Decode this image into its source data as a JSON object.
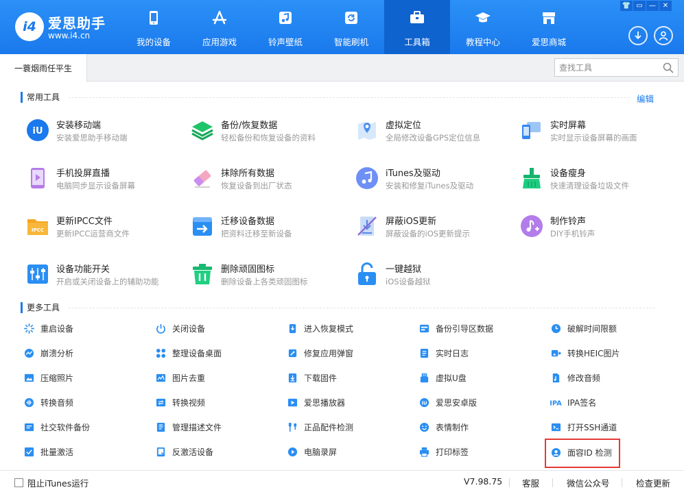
{
  "brand": {
    "name": "爱思助手",
    "url": "www.i4.cn",
    "badge": "i4"
  },
  "nav": [
    {
      "label": "我的设备",
      "icon": "phone-icon"
    },
    {
      "label": "应用游戏",
      "icon": "app-store-icon"
    },
    {
      "label": "铃声壁纸",
      "icon": "music-icon"
    },
    {
      "label": "智能刷机",
      "icon": "refresh-icon"
    },
    {
      "label": "工具箱",
      "icon": "toolbox-icon",
      "active": true
    },
    {
      "label": "教程中心",
      "icon": "graduation-cap-icon"
    },
    {
      "label": "爱思商城",
      "icon": "shop-icon"
    }
  ],
  "window_controls": [
    "👕",
    "▭",
    "—",
    "✕"
  ],
  "tab": {
    "label": "一蓑烟雨任平生"
  },
  "search": {
    "placeholder": "查找工具"
  },
  "common": {
    "title": "常用工具",
    "edit": "编辑",
    "tools": [
      {
        "title": "安装移动端",
        "desc": "安装爱思助手移动端",
        "icon": "i4-app-icon"
      },
      {
        "title": "备份/恢复数据",
        "desc": "轻松备份和恢复设备的资料",
        "icon": "layers-icon"
      },
      {
        "title": "虚拟定位",
        "desc": "全局修改设备GPS定位信息",
        "icon": "map-pin-icon"
      },
      {
        "title": "实时屏幕",
        "desc": "实时显示设备屏幕的画面",
        "icon": "screen-mirror-icon"
      },
      {
        "title": "手机投屏直播",
        "desc": "电脑同步显示设备屏幕",
        "icon": "phone-cast-icon"
      },
      {
        "title": "抹除所有数据",
        "desc": "恢复设备到出厂状态",
        "icon": "eraser-icon"
      },
      {
        "title": "iTunes及驱动",
        "desc": "安装和修复iTunes及驱动",
        "icon": "itunes-icon"
      },
      {
        "title": "设备瘦身",
        "desc": "快速清理设备垃圾文件",
        "icon": "broom-icon"
      },
      {
        "title": "更新IPCC文件",
        "desc": "更新IPCC运营商文件",
        "icon": "ipcc-folder-icon"
      },
      {
        "title": "迁移设备数据",
        "desc": "把资料迁移至新设备",
        "icon": "migrate-icon"
      },
      {
        "title": "屏蔽iOS更新",
        "desc": "屏蔽设备的iOS更新提示",
        "icon": "block-update-icon"
      },
      {
        "title": "制作铃声",
        "desc": "DIY手机铃声",
        "icon": "ringtone-icon"
      },
      {
        "title": "设备功能开关",
        "desc": "开启或关闭设备上的辅助功能",
        "icon": "switches-icon"
      },
      {
        "title": "删除顽固图标",
        "desc": "删除设备上各类顽固图标",
        "icon": "trash-icon"
      },
      {
        "title": "一键越狱",
        "desc": "iOS设备越狱",
        "icon": "unlock-icon"
      }
    ]
  },
  "more": {
    "title": "更多工具",
    "items": [
      {
        "label": "重启设备",
        "icon": "spinner-icon"
      },
      {
        "label": "关闭设备",
        "icon": "power-icon"
      },
      {
        "label": "进入恢复模式",
        "icon": "recovery-icon"
      },
      {
        "label": "备份引导区数据",
        "icon": "boot-backup-icon"
      },
      {
        "label": "破解时间限额",
        "icon": "clock-icon"
      },
      {
        "label": "崩溃分析",
        "icon": "crash-chart-icon"
      },
      {
        "label": "整理设备桌面",
        "icon": "grid-icon"
      },
      {
        "label": "修复应用弹窗",
        "icon": "repair-icon"
      },
      {
        "label": "实时日志",
        "icon": "log-icon"
      },
      {
        "label": "转换HEIC图片",
        "icon": "convert-image-icon"
      },
      {
        "label": "压缩照片",
        "icon": "photo-icon"
      },
      {
        "label": "图片去重",
        "icon": "dedupe-icon"
      },
      {
        "label": "下载固件",
        "icon": "download-icon"
      },
      {
        "label": "虚拟U盘",
        "icon": "usb-icon"
      },
      {
        "label": "修改音频",
        "icon": "audio-edit-icon"
      },
      {
        "label": "转换音频",
        "icon": "audio-convert-icon"
      },
      {
        "label": "转换视频",
        "icon": "video-convert-icon"
      },
      {
        "label": "爱思播放器",
        "icon": "player-icon"
      },
      {
        "label": "爱思安卓版",
        "icon": "android-icon"
      },
      {
        "label": "IPA签名",
        "icon": "ipa-icon"
      },
      {
        "label": "社交软件备份",
        "icon": "social-backup-icon"
      },
      {
        "label": "管理描述文件",
        "icon": "profile-icon"
      },
      {
        "label": "正品配件检测",
        "icon": "accessory-icon"
      },
      {
        "label": "表情制作",
        "icon": "emoji-icon"
      },
      {
        "label": "打开SSH通道",
        "icon": "terminal-icon"
      },
      {
        "label": "批量激活",
        "icon": "checkbox-icon"
      },
      {
        "label": "反激活设备",
        "icon": "deactivate-icon"
      },
      {
        "label": "电脑录屏",
        "icon": "record-icon"
      },
      {
        "label": "打印标签",
        "icon": "printer-icon"
      },
      {
        "label": "面容ID 检测",
        "icon": "face-id-icon",
        "highlighted": true
      }
    ]
  },
  "footer": {
    "checkbox_label": "阻止iTunes运行",
    "checked": false,
    "version": "V7.98.75",
    "service": "客服",
    "wechat": "微信公众号",
    "update": "检查更新"
  },
  "colors": {
    "primary": "#1a79ec",
    "highlight_border": "#e53935"
  }
}
